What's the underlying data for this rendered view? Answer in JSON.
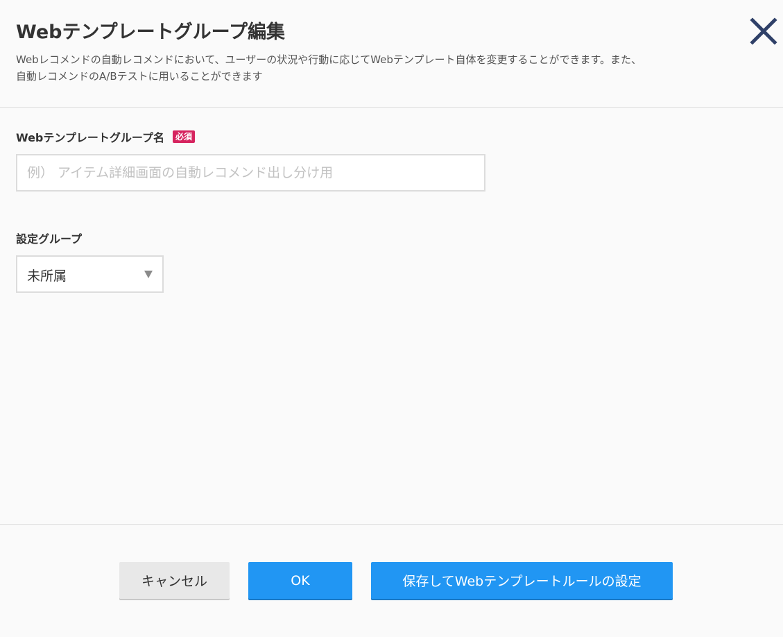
{
  "dialog": {
    "title": "Webテンプレートグループ編集",
    "description_lines": [
      "Webレコメンドの自動レコメンドにおいて、ユーザーの状況や行動に応じてWebテンプレート自体を変更することができます。また、",
      "自動レコメンドのA/Bテストに用いることができます"
    ],
    "close_icon": "close-icon"
  },
  "form": {
    "name_field": {
      "label": "Webテンプレートグループ名",
      "required_badge": "必須",
      "value": "",
      "placeholder": "例） アイテム詳細画面の自動レコメンド出し分け用"
    },
    "group_field": {
      "label": "設定グループ",
      "selected": "未所属",
      "arrow_icon": "dropdown-arrow-icon"
    }
  },
  "footer": {
    "cancel_label": "キャンセル",
    "ok_label": "OK",
    "save_label": "保存してWebテンプレートルールの設定"
  },
  "colors": {
    "primary": "#2196f3",
    "required": "#d6245f",
    "close_icon": "#2f4068",
    "background": "#fafafa"
  }
}
